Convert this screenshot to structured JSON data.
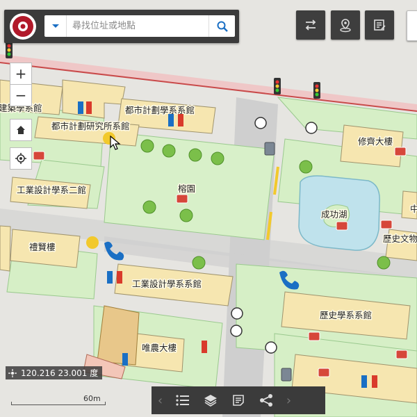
{
  "map": {
    "labels": {
      "arch": "建築學系館",
      "urban": "都市計劃學系系館",
      "urban_inst": "都市計劃研究所系館",
      "xiuqi": "修齊大樓",
      "rong": "榕園",
      "industrial2": "工業設計學系二館",
      "chenggong": "成功湖",
      "history_museum": "歷史文物",
      "lixian": "禮賢樓",
      "industrial": "工業設計學系系館",
      "history": "歷史學系系館",
      "weinong": "唯農大樓",
      "zhong": "中"
    }
  },
  "search": {
    "placeholder": "尋找位址或地點"
  },
  "coords": {
    "text": "120.216 23.001 度"
  },
  "scale": {
    "label": "60m"
  },
  "colors": {
    "toolbar": "#3b3b3b",
    "building": "#f6e6b0",
    "green": "#d6efc6",
    "road": "#cfcfcf",
    "water": "#bfe2ec",
    "campus_border": "#c94a4a",
    "accent_blue": "#1a6fc4"
  }
}
